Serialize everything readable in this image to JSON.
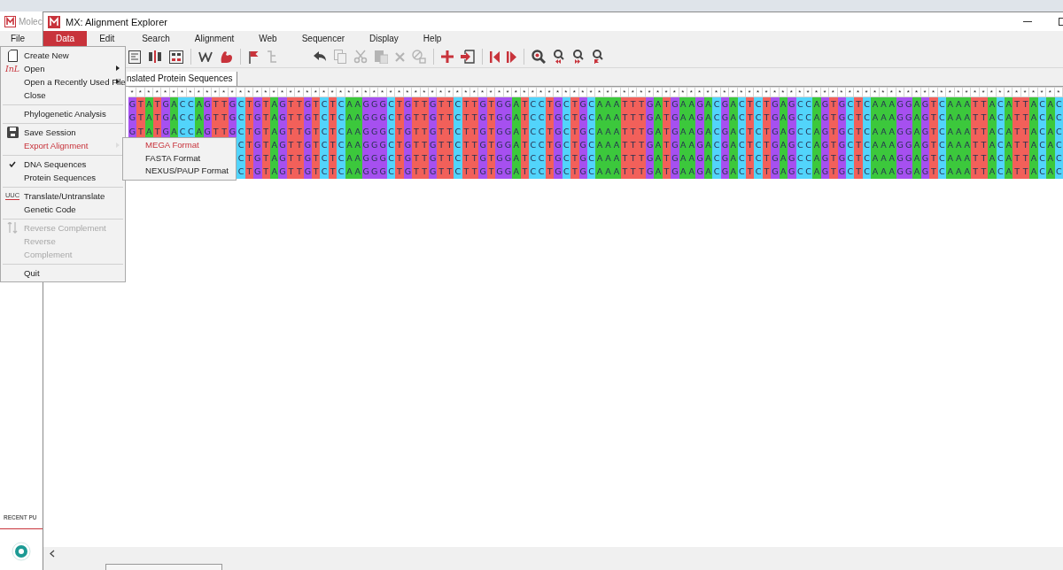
{
  "background_app": {
    "title": "Molec",
    "menu": [
      "File"
    ],
    "section": "RECENT PU"
  },
  "window": {
    "title": "MX: Alignment Explorer"
  },
  "menubar": [
    {
      "label": "Data",
      "selected": true
    },
    {
      "label": "Edit",
      "selected": false
    },
    {
      "label": "Search",
      "selected": false
    },
    {
      "label": "Alignment",
      "selected": false
    },
    {
      "label": "Web",
      "selected": false
    },
    {
      "label": "Sequencer",
      "selected": false
    },
    {
      "label": "Display",
      "selected": false
    },
    {
      "label": "Help",
      "selected": false
    }
  ],
  "toolbar": [
    {
      "kind": "list",
      "disabled": false
    },
    {
      "kind": "columns",
      "disabled": false
    },
    {
      "kind": "bases",
      "disabled": false
    },
    {
      "kind": "separator"
    },
    {
      "kind": "zigzag",
      "disabled": false
    },
    {
      "kind": "arm",
      "disabled": false
    },
    {
      "kind": "separator"
    },
    {
      "kind": "flag",
      "disabled": false
    },
    {
      "kind": "tree",
      "disabled": true
    },
    {
      "kind": "gap"
    },
    {
      "kind": "undo",
      "disabled": false
    },
    {
      "kind": "copy",
      "disabled": true
    },
    {
      "kind": "cut",
      "disabled": true
    },
    {
      "kind": "paste",
      "disabled": true
    },
    {
      "kind": "delete",
      "disabled": true
    },
    {
      "kind": "erase",
      "disabled": true
    },
    {
      "kind": "separator"
    },
    {
      "kind": "plus",
      "disabled": false
    },
    {
      "kind": "import",
      "disabled": false
    },
    {
      "kind": "separator"
    },
    {
      "kind": "step-left",
      "disabled": false
    },
    {
      "kind": "step-right",
      "disabled": false
    },
    {
      "kind": "separator"
    },
    {
      "kind": "search",
      "disabled": false
    },
    {
      "kind": "search-prev",
      "disabled": false
    },
    {
      "kind": "search-next",
      "disabled": false
    },
    {
      "kind": "search-flag",
      "disabled": false
    }
  ],
  "tab": {
    "label": "nslated Protein Sequences"
  },
  "alignment": {
    "conservation": "* * * * * * * * * * * * * * * * * * * * * * * * * * * * * * * * * * * * * * * * * * * * * * * * * * * * * * * * * * * * * * * * * * * * * * * * * * * * * * * * * * * * * * * * * * * * * * * * * * * * * * * * * * * * * * * *",
    "rows": [
      "G T A T G A C C A G T T G C T G T A G T T G T C T C A A G G G C T G T T G T T C T T G T G G A T C C T G C T G C A A A T T T G A T G A A G A C G A C T C T G A G C C A G T G C T C A A A G G A G T C A A A T T A C A T T A C A C",
      "G T A T G A C C A G T T G C T G T A G T T G T C T C A A G G G C T G T T G T T C T T G T G G A T C C T G C T G C A A A T T T G A T G A A G A C G A C T C T G A G C C A G T G C T C A A A G G A G T C A A A T T A C A T T A C A C",
      "G T A T G A C C A G T T G C T G T A G T T G T C T C A A G G G C T G T T G T T C T T G T G G A T C C T G C T G C A A A T T T G A T G A A G A C G A C T C T G A G C C A G T G C T C A A A G G A G T C A A A T T A C A T T A C A C",
      "C T G T A G T T G T C T C A A G G G C T G T T G T T C T T G T G G A T C C T G C T G C A A A T T T G A T G A A G A C G A C T C T G A G C C A G T G C T C A A A G G A G T C A A A T T A C A T T A C A C",
      "C T G T A G T T G T C T C A A G G G C T G T T G T T C T T G T G G A T C C T G C T G C A A A T T T G A T G A A G A C G A C T C T G A G C C A G T G C T C A A A G G A G T C A A A T T A C A T T A C A C",
      "C T G T A G T T G T C T C A A G G G C T G T T G T T C T T G T G G A T C C T G C T G C A A A T T T G A T G A A G A C G A C T C T G A G C C A G T G C T C A A A G G A G T C A A A T T A C A T T A C A C"
    ]
  },
  "data_menu": [
    {
      "kind": "item",
      "label": "Create New",
      "submenu": false,
      "disabled": false,
      "checked": false,
      "highlighted": false
    },
    {
      "kind": "item",
      "label": "Open",
      "icon_text": "InL",
      "submenu": true,
      "disabled": false,
      "checked": false,
      "highlighted": false
    },
    {
      "kind": "item",
      "label": "Open a Recently Used File",
      "submenu": true,
      "disabled": false,
      "checked": false,
      "highlighted": false
    },
    {
      "kind": "item",
      "label": "Close",
      "submenu": false,
      "disabled": false,
      "checked": false,
      "highlighted": false
    },
    {
      "kind": "separator"
    },
    {
      "kind": "item",
      "label": "Phylogenetic Analysis",
      "submenu": false,
      "disabled": false,
      "checked": false,
      "highlighted": false
    },
    {
      "kind": "separator"
    },
    {
      "kind": "item",
      "label": "Save Session",
      "submenu": false,
      "disabled": false,
      "checked": false,
      "highlighted": false
    },
    {
      "kind": "item",
      "label": "Export Alignment",
      "submenu": true,
      "disabled": false,
      "checked": false,
      "highlighted": true
    },
    {
      "kind": "separator"
    },
    {
      "kind": "item",
      "label": "DNA Sequences",
      "submenu": false,
      "disabled": false,
      "checked": true,
      "highlighted": false
    },
    {
      "kind": "item",
      "label": "Protein Sequences",
      "submenu": false,
      "disabled": false,
      "checked": false,
      "highlighted": false
    },
    {
      "kind": "separator"
    },
    {
      "kind": "item",
      "label": "Translate/Untranslate",
      "icon_text": "UUC",
      "submenu": false,
      "disabled": false,
      "checked": false,
      "highlighted": false
    },
    {
      "kind": "item",
      "label": "Genetic Code",
      "submenu": false,
      "disabled": false,
      "checked": false,
      "highlighted": false
    },
    {
      "kind": "separator"
    },
    {
      "kind": "item",
      "label": "Reverse Complement",
      "submenu": false,
      "disabled": true,
      "checked": false,
      "highlighted": false
    },
    {
      "kind": "item",
      "label": "Reverse",
      "submenu": false,
      "disabled": true,
      "checked": false,
      "highlighted": false
    },
    {
      "kind": "item",
      "label": "Complement",
      "submenu": false,
      "disabled": true,
      "checked": false,
      "highlighted": false
    },
    {
      "kind": "separator"
    },
    {
      "kind": "item",
      "label": "Quit",
      "submenu": false,
      "disabled": false,
      "checked": false,
      "highlighted": false
    }
  ],
  "export_submenu": [
    {
      "label": "MEGA Format",
      "highlighted": true
    },
    {
      "label": "FASTA Format",
      "highlighted": false
    },
    {
      "label": "NEXUS/PAUP Format",
      "highlighted": false
    }
  ]
}
